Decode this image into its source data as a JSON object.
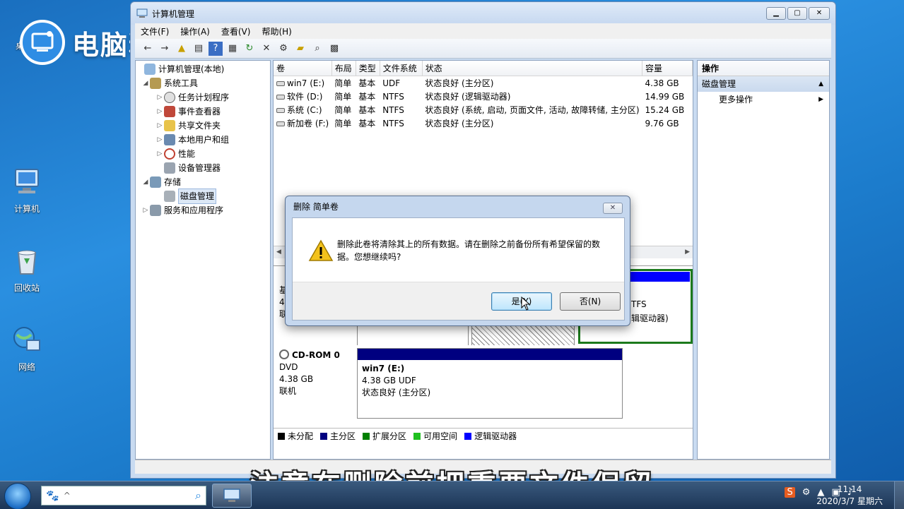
{
  "brand": {
    "logo_text": "电脑粉"
  },
  "desktop": {
    "icons": [
      {
        "label": "桌面"
      },
      {
        "label": "计算机"
      },
      {
        "label": "回收站"
      },
      {
        "label": "网络"
      }
    ]
  },
  "window": {
    "title": "计算机管理",
    "menu": [
      "文件(F)",
      "操作(A)",
      "查看(V)",
      "帮助(H)"
    ]
  },
  "tree": {
    "root": "计算机管理(本地)",
    "items": [
      {
        "label": "系统工具"
      },
      {
        "label": "任务计划程序"
      },
      {
        "label": "事件查看器"
      },
      {
        "label": "共享文件夹"
      },
      {
        "label": "本地用户和组"
      },
      {
        "label": "性能"
      },
      {
        "label": "设备管理器"
      },
      {
        "label": "存储"
      },
      {
        "label": "磁盘管理"
      },
      {
        "label": "服务和应用程序"
      }
    ]
  },
  "volumes": {
    "headers": [
      "卷",
      "布局",
      "类型",
      "文件系统",
      "状态",
      "容量"
    ],
    "rows": [
      {
        "name": "win7 (E:)",
        "layout": "简单",
        "type": "基本",
        "fs": "UDF",
        "status": "状态良好 (主分区)",
        "size": "4.38 GB"
      },
      {
        "name": "软件 (D:)",
        "layout": "简单",
        "type": "基本",
        "fs": "NTFS",
        "status": "状态良好 (逻辑驱动器)",
        "size": "14.99 GB"
      },
      {
        "name": "系统 (C:)",
        "layout": "简单",
        "type": "基本",
        "fs": "NTFS",
        "status": "状态良好 (系统, 启动, 页面文件, 活动, 故障转储, 主分区)",
        "size": "15.24 GB"
      },
      {
        "name": "新加卷 (F:)",
        "layout": "简单",
        "type": "基本",
        "fs": "NTFS",
        "status": "状态良好 (主分区)",
        "size": "9.76 GB"
      }
    ]
  },
  "graph": {
    "disk0": {
      "line1": "基",
      "line2": "4",
      "line3": "联"
    },
    "partial_part": {
      "fs": "TFS",
      "status": "辑驱动器)"
    },
    "cdrom": {
      "name": "CD-ROM 0",
      "type": "DVD",
      "size": "4.38 GB",
      "state": "联机"
    },
    "cd_part": {
      "name": "win7  (E:)",
      "fs": "4.38 GB UDF",
      "status": "状态良好 (主分区)"
    },
    "legend": [
      {
        "label": "未分配",
        "color": "#000000"
      },
      {
        "label": "主分区",
        "color": "#000080"
      },
      {
        "label": "扩展分区",
        "color": "#008000"
      },
      {
        "label": "可用空间",
        "color": "#20c020"
      },
      {
        "label": "逻辑驱动器",
        "color": "#0000ff"
      }
    ]
  },
  "actions": {
    "header": "操作",
    "selected": "磁盘管理",
    "more": "更多操作"
  },
  "dialog": {
    "title": "删除 简单卷",
    "message": "删除此卷将清除其上的所有数据。请在删除之前备份所有希望保留的数据。您想继续吗?",
    "yes": "是(Y)",
    "no": "否(N)"
  },
  "subtitle": "注意在删除前把重要文件保留",
  "taskbar": {
    "time": "11:14",
    "date": "2020/3/7 星期六"
  }
}
